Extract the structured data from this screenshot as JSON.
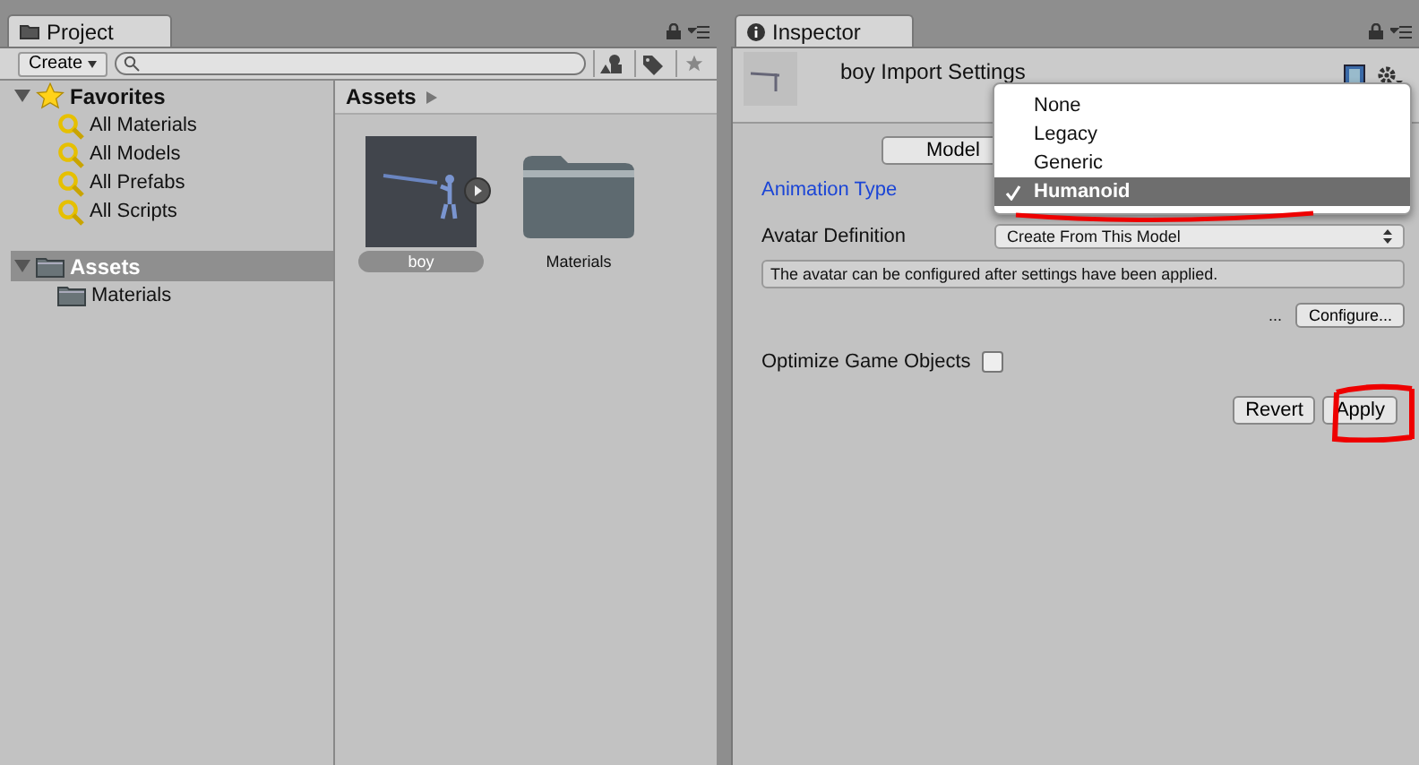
{
  "project": {
    "tab": "Project",
    "create_button": "Create",
    "tree": [
      {
        "label": "Favorites",
        "kind": "favorites",
        "expanded": true,
        "selected": false,
        "children": [
          {
            "label": "All Materials",
            "kind": "search",
            "selected": false
          },
          {
            "label": "All Models",
            "kind": "search",
            "selected": false
          },
          {
            "label": "All Prefabs",
            "kind": "search",
            "selected": false
          },
          {
            "label": "All Scripts",
            "kind": "search",
            "selected": false
          }
        ]
      },
      {
        "label": "Assets",
        "kind": "folder",
        "expanded": true,
        "selected": true,
        "children": [
          {
            "label": "Materials",
            "kind": "folder",
            "selected": false
          }
        ]
      }
    ],
    "breadcrumb": "Assets",
    "assets": [
      {
        "label": "boy",
        "kind": "model",
        "selected": true
      },
      {
        "label": "Materials",
        "kind": "folder",
        "selected": false
      }
    ]
  },
  "inspector": {
    "tab": "Inspector",
    "title": "boy Import Settings",
    "tab_button": "Model",
    "animation_type_label": "Animation Type",
    "avatar_definition": {
      "label": "Avatar Definition",
      "value": "Create From This Model"
    },
    "help_text": "The avatar can be configured after settings have been applied.",
    "ellipsis": "...",
    "configure_button": "Configure...",
    "optimize": {
      "label": "Optimize Game Objects",
      "checked": false
    },
    "buttons": [
      "Revert",
      "Apply"
    ],
    "dropdown": [
      {
        "label": "None",
        "selected": false
      },
      {
        "label": "Legacy",
        "selected": false
      },
      {
        "label": "Generic",
        "selected": false
      },
      {
        "label": "Humanoid",
        "selected": true
      }
    ]
  }
}
